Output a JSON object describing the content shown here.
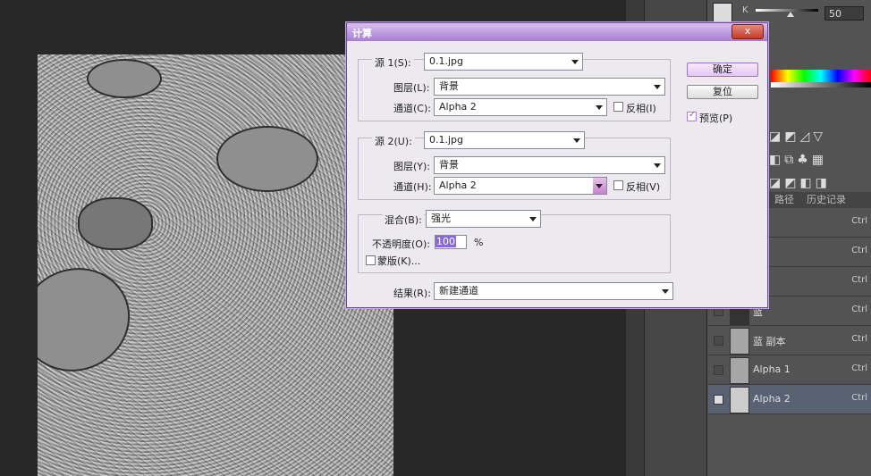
{
  "dialog": {
    "title": "计算",
    "close_label": "x",
    "source1": {
      "label": "源 1(S):",
      "file": "0.1.jpg",
      "layer_label": "图层(L):",
      "layer_value": "背景",
      "channel_label": "通道(C):",
      "channel_value": "Alpha 2",
      "invert_label": "反相(I)"
    },
    "source2": {
      "label": "源 2(U):",
      "file": "0.1.jpg",
      "layer_label": "图层(Y):",
      "layer_value": "背景",
      "channel_label": "通道(H):",
      "channel_value": "Alpha 2",
      "invert_label": "反相(V)"
    },
    "blend": {
      "label": "混合(B):",
      "mode": "强光",
      "opacity_label": "不透明度(O):",
      "opacity_value": "100",
      "opacity_unit": "%",
      "mask_label": "蒙版(K)..."
    },
    "result": {
      "label": "结果(R):",
      "value": "新建通道"
    },
    "buttons": {
      "ok": "确定",
      "reset": "复位",
      "preview": "预览(P)"
    }
  },
  "color_panel": {
    "k_label": "K",
    "k_value": "50"
  },
  "tabs": [
    "路径",
    "历史记录"
  ],
  "channels": [
    {
      "name": "",
      "shortcut": "Ctrl",
      "selected": false
    },
    {
      "name": "",
      "shortcut": "Ctrl",
      "selected": false
    },
    {
      "name": "",
      "shortcut": "Ctrl",
      "selected": false
    },
    {
      "name": "蓝",
      "shortcut": "Ctrl",
      "selected": false
    },
    {
      "name": "蓝 副本",
      "shortcut": "Ctrl",
      "selected": false
    },
    {
      "name": "Alpha 1",
      "shortcut": "Ctrl",
      "selected": false
    },
    {
      "name": "Alpha 2",
      "shortcut": "Ctrl",
      "selected": true
    }
  ],
  "adjustment_icons": "◪◩◿▽ ◧⧉♣▦ ◪◩◧◨",
  "colors": {
    "dialog_accent": "#a77fd0",
    "canvas_gray": "#9c9c9c",
    "selected_row": "#586272"
  }
}
